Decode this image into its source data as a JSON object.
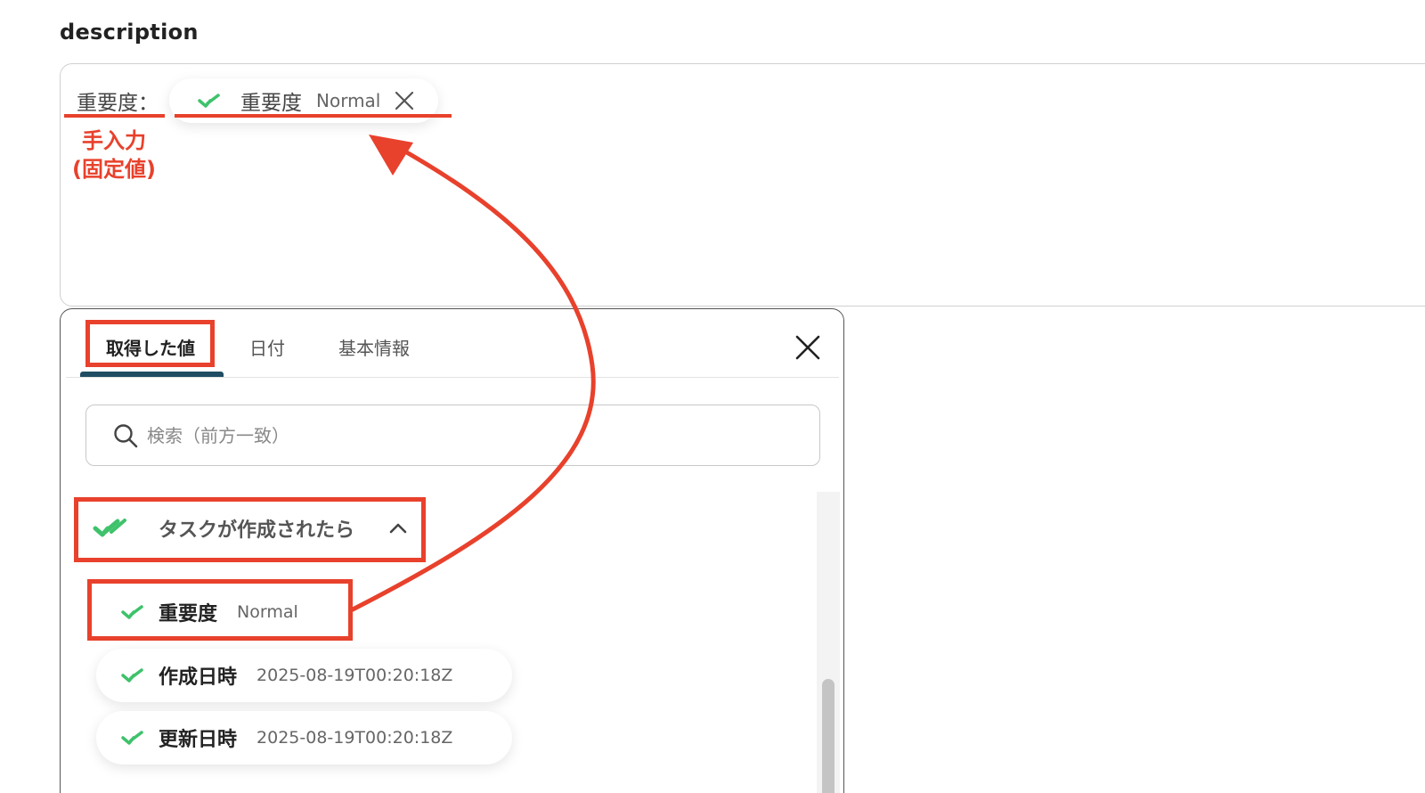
{
  "field": {
    "label": "description"
  },
  "editor": {
    "static_text": "重要度：",
    "chip": {
      "name": "重要度",
      "value": "Normal",
      "icon": "check-icon",
      "close_icon": "close-icon"
    }
  },
  "annotation": {
    "line1": "手入力",
    "line2": "(固定値)",
    "color": "#e8412c"
  },
  "picker": {
    "tabs": [
      {
        "label": "取得した値",
        "active": true
      },
      {
        "label": "日付",
        "active": false
      },
      {
        "label": "基本情報",
        "active": false
      }
    ],
    "search": {
      "placeholder": "検索（前方一致）"
    },
    "group": {
      "title": "タスクが作成されたら",
      "icon": "check-icon",
      "expanded": true
    },
    "items": [
      {
        "name": "重要度",
        "value": "Normal"
      },
      {
        "name": "作成日時",
        "value": "2025-08-19T00:20:18Z"
      },
      {
        "name": "更新日時",
        "value": "2025-08-19T00:20:18Z"
      }
    ]
  },
  "colors": {
    "accent": "#1f4d63",
    "check": "#3ec26b",
    "highlight": "#e8412c"
  }
}
